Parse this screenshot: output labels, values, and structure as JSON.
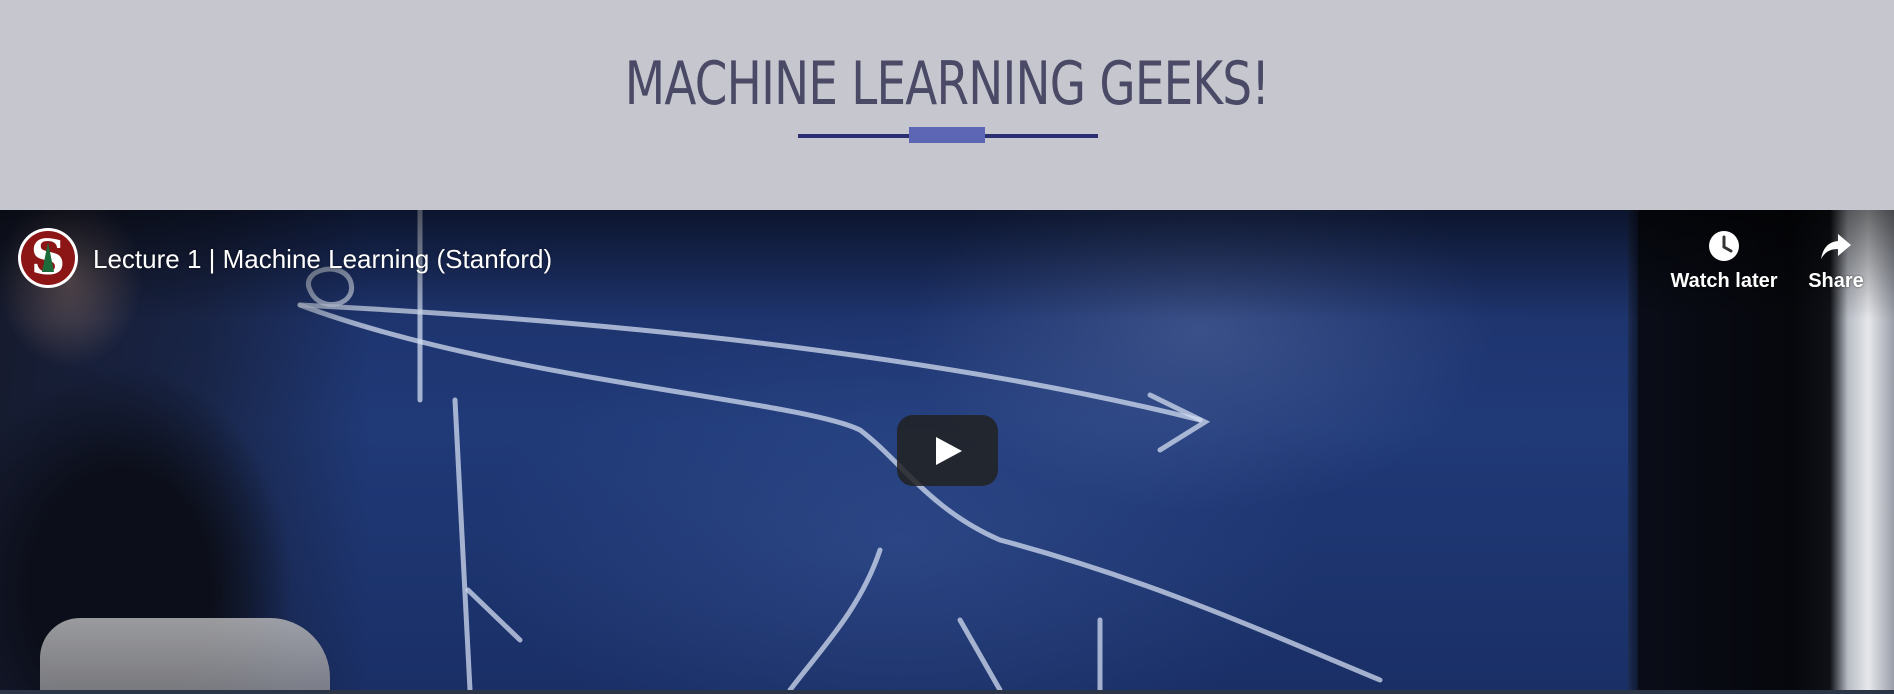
{
  "header": {
    "title": "MACHINE LEARNING GEEKS!"
  },
  "video": {
    "title": "Lecture 1 | Machine Learning (Stanford)",
    "channel_avatar_letter": "S",
    "controls": {
      "watch_later_label": "Watch later",
      "share_label": "Share"
    },
    "icons": {
      "watch_later": "clock-icon",
      "share": "share-arrow-icon",
      "play": "play-icon"
    }
  },
  "colors": {
    "page_background": "#c6c6cf",
    "title_color": "#4a4a66",
    "rule_dark": "#2a2f72",
    "rule_accent": "#5c66b4",
    "avatar_red": "#8c1515"
  }
}
